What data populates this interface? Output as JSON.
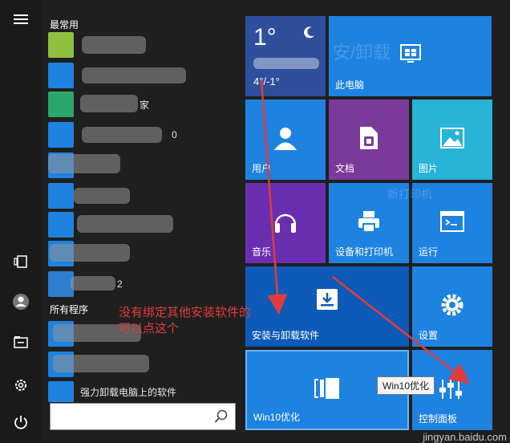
{
  "rail": {
    "icons": [
      "hamburger-menu-icon",
      "tablet-mode-icon",
      "user-account-icon",
      "file-explorer-icon",
      "settings-icon",
      "power-icon"
    ]
  },
  "applist": {
    "most_used_label": "最常用",
    "all_programs_label": "所有程序",
    "visible_partial": {
      "row3_suffix": "家",
      "row4_suffix": "0",
      "row8_suffix": "2",
      "last_app": "强力卸载电脑上的软件"
    },
    "icon_colors": [
      "#8fbf3f",
      "#1e82e0",
      "#29a86b",
      "#1e82e0",
      "#1e82e0",
      "#1e82e0",
      "#1e82e0",
      "#1e82e0",
      "#2f7fd0",
      "#1e82e0",
      "#1e82e0",
      "#1e82e0"
    ]
  },
  "search": {
    "placeholder": ""
  },
  "tiles": {
    "weather": {
      "temp": "1°",
      "range": "4°/-1°"
    },
    "this_pc": "此电脑",
    "users": "用户",
    "documents": "文档",
    "pictures": "图片",
    "music": "音乐",
    "devices_printers": "设备和打印机",
    "run": "运行",
    "install_uninstall": "安装与卸载软件",
    "settings": "设置",
    "win10_optimize": "Win10优化",
    "control_panel": "控制面板"
  },
  "watermarks": {
    "a": "安/卸载",
    "b": "新打印机"
  },
  "annotation": {
    "line1": "没有绑定其他安装软件的",
    "line2": "可以点这个"
  },
  "tooltip": "Win10优化",
  "site_watermark": "jingyan.baidu.com",
  "colors": {
    "tile_blue": "#1e82e0",
    "tile_purple": "#7a3a9a",
    "tile_teal": "#27b4d8",
    "arrow_red": "#e23b3b"
  }
}
